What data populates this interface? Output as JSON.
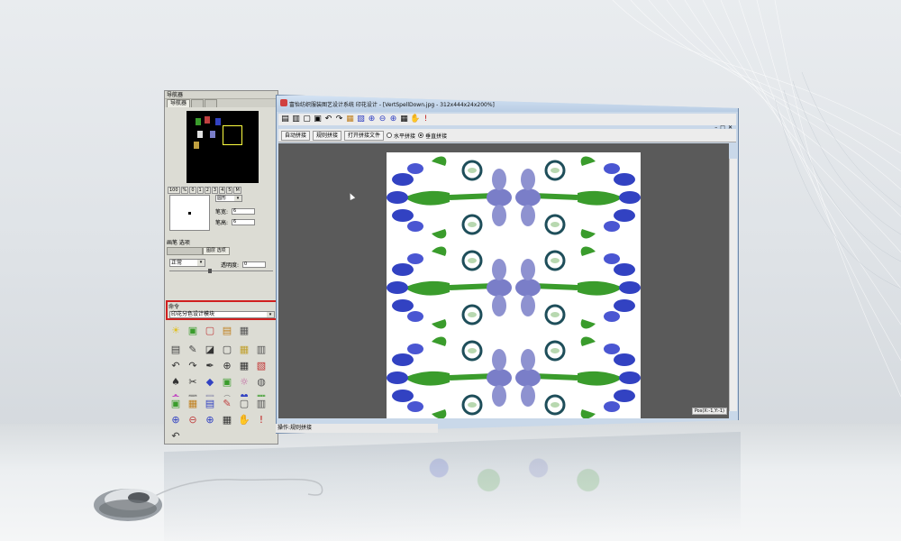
{
  "navigator": {
    "title": "导航器",
    "tabs": [
      "导航器",
      "",
      ""
    ],
    "zoom_levels": [
      "100",
      "%",
      "0",
      "1",
      "2",
      "3",
      "4",
      "5",
      "M"
    ],
    "brush_shape": "圆形",
    "brush_width_label": "笔宽:",
    "brush_width_value": "6",
    "brush_height_label": "笔高:",
    "brush_height_value": "6"
  },
  "brush_options": {
    "section_label": "画笔 选项",
    "tabs": [
      "",
      "图层 选项"
    ],
    "mode": "正常",
    "opacity_label": "透明度:",
    "opacity_value": "0"
  },
  "command": {
    "label": "命令",
    "selected": "印花分色设计模块"
  },
  "tools_row1": [
    "☀",
    "▣",
    "▢",
    "▤",
    "▦"
  ],
  "tools_grid": [
    "▤",
    "✎",
    "◪",
    "▢",
    "▦",
    "▥",
    "↶",
    "↷",
    "✒",
    "⊕",
    "▦",
    "▧",
    "♠",
    "✂",
    "◆",
    "▣",
    "☼",
    "◍",
    "✿",
    "▣",
    "▤",
    "◎",
    "♥",
    "▦"
  ],
  "tools_bottom": [
    "▣",
    "▦",
    "▤",
    "✎",
    "▢",
    "▥",
    "⊕",
    "⊖",
    "⊕",
    "▦",
    "✋",
    "!",
    "↶"
  ],
  "main_window": {
    "title": "富怡纺织服装图艺设计系统  印花设计 - [VertSpellDown.jpg - 312x444x24x200%]",
    "toolbar_icons": [
      "▤",
      "▥",
      "▢",
      "▣",
      "↶",
      "↷",
      "▦",
      "▧",
      "⊕",
      "⊖",
      "⊕",
      "▦",
      "✋",
      "!"
    ],
    "tile_buttons": [
      "自动拼接",
      "规则拼接",
      "打开拼接文件"
    ],
    "radio_horizontal": "水平拼接",
    "radio_vertical": "垂直拼接",
    "status_text": "操作:规则拼接",
    "pos_text": "Pos(X:-1,Y:-1)"
  },
  "colors": {
    "blue": "#3242c2",
    "green": "#3a9c2c",
    "purple": "#7a7ec8",
    "teal": "#1e4e5a",
    "red_outline": "#d02020"
  }
}
